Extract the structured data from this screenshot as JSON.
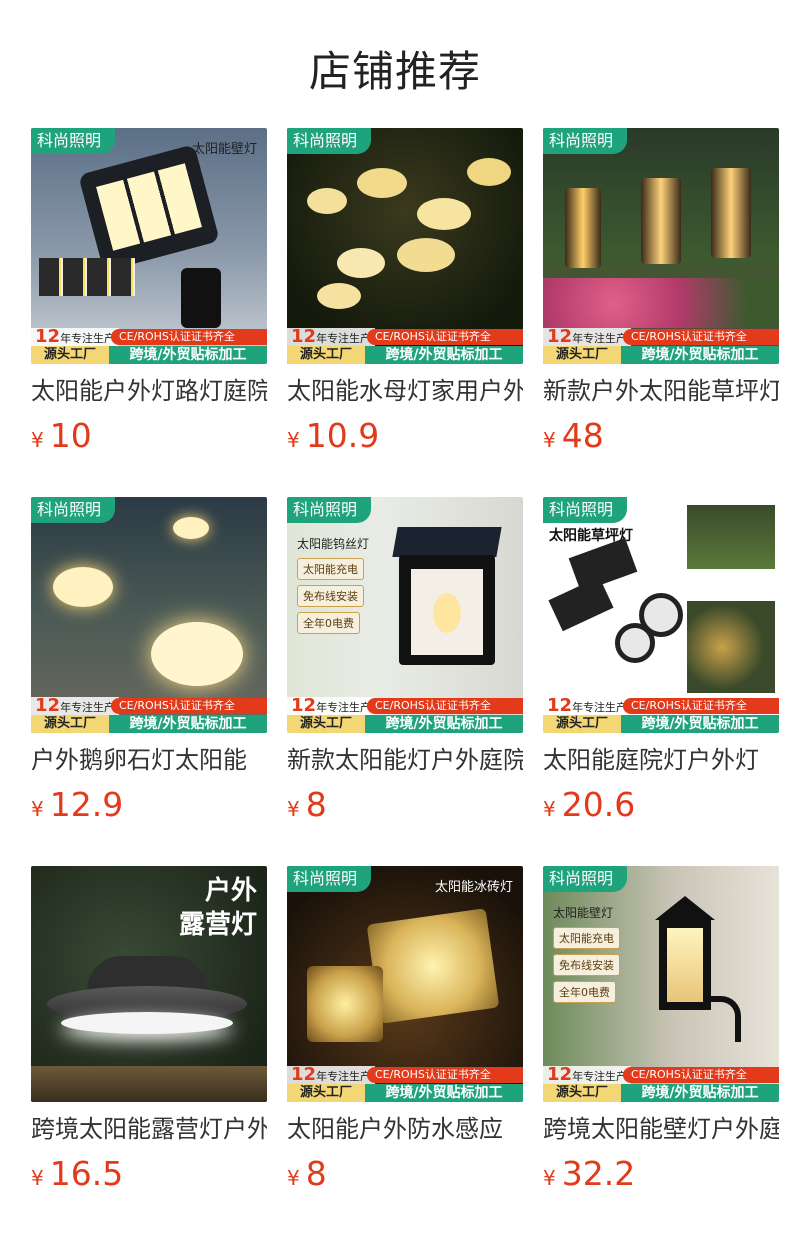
{
  "page_title": "店铺推荐",
  "banner": {
    "years_num": "12",
    "years_text": "年专注生产",
    "cert": "CE/ROHS认证证书齐全",
    "source": "源头工厂",
    "service": "跨境/外贸贴标加工"
  },
  "brand_tag": "科尚照明",
  "currency": "¥",
  "products": [
    {
      "name": "太阳能户外灯路灯庭院灯",
      "price": "10",
      "caption": "太阳能壁灯",
      "has_brand": true,
      "has_banner": true
    },
    {
      "name": "太阳能水母灯家用户外",
      "price": "10.9",
      "caption": "",
      "has_brand": true,
      "has_banner": true
    },
    {
      "name": "新款户外太阳能草坪灯",
      "price": "48",
      "caption": "",
      "has_brand": true,
      "has_banner": true
    },
    {
      "name": "户外鹅卵石灯太阳能",
      "price": "12.9",
      "caption": "",
      "has_brand": true,
      "has_banner": true
    },
    {
      "name": "新款太阳能灯户外庭院",
      "price": "8",
      "caption": "太阳能钨丝灯",
      "features": [
        "太阳能充电",
        "免布线安装",
        "全年0电费"
      ],
      "has_brand": true,
      "has_banner": true
    },
    {
      "name": "太阳能庭院灯户外灯",
      "price": "20.6",
      "caption": "太阳能草坪灯",
      "has_brand": true,
      "has_banner": true
    },
    {
      "name": "跨境太阳能露营灯户外",
      "price": "16.5",
      "caption_lines": [
        "户外",
        "露营灯"
      ],
      "has_brand": false,
      "has_banner": false
    },
    {
      "name": "太阳能户外防水感应",
      "price": "8",
      "caption": "太阳能冰砖灯",
      "has_brand": true,
      "has_banner": true
    },
    {
      "name": "跨境太阳能壁灯户外庭院",
      "price": "32.2",
      "caption": "太阳能壁灯",
      "features": [
        "太阳能充电",
        "免布线安装",
        "全年0电费"
      ],
      "has_brand": true,
      "has_banner": true
    }
  ]
}
